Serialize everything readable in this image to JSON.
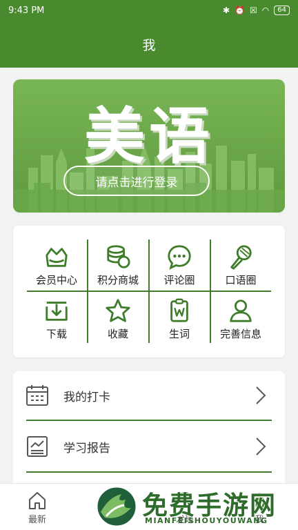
{
  "status": {
    "time": "9:43 PM",
    "battery": "64"
  },
  "header": {
    "title": "我"
  },
  "banner": {
    "title": "美语",
    "login_label": "请点击进行登录"
  },
  "grid": [
    {
      "label": "会员中心",
      "icon": "crown-icon"
    },
    {
      "label": "积分商城",
      "icon": "coins-icon"
    },
    {
      "label": "评论圈",
      "icon": "chat-bubble-icon"
    },
    {
      "label": "口语圈",
      "icon": "microphone-icon"
    },
    {
      "label": "下载",
      "icon": "download-icon"
    },
    {
      "label": "收藏",
      "icon": "star-icon"
    },
    {
      "label": "生词",
      "icon": "vocabulary-icon"
    },
    {
      "label": "完善信息",
      "icon": "user-icon"
    }
  ],
  "list": [
    {
      "label": "我的打卡",
      "icon": "calendar-icon"
    },
    {
      "label": "学习报告",
      "icon": "report-icon"
    }
  ],
  "tabs": [
    {
      "label": "最新",
      "icon": "home-icon"
    },
    {
      "label": "发现",
      "icon": "discover-icon"
    },
    {
      "label": "我",
      "icon": "profile-icon"
    }
  ],
  "watermark": {
    "title": "免费手游网",
    "subtitle": "MIANFEISHOUYOUWANG"
  },
  "colors": {
    "primary": "#4a8a2e",
    "accent_line": "#3f7d2a",
    "icon": "#3f7d2a"
  }
}
